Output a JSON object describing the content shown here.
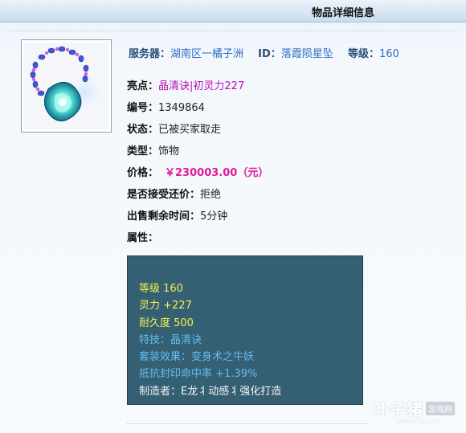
{
  "title": "物品详细信息",
  "header": {
    "server_label": "服务器：",
    "server_value": "湖南区一橘子洲",
    "id_label": "ID：",
    "id_value": "落霞陨星坠",
    "level_label": "等级：",
    "level_value": "160"
  },
  "details": {
    "highlight_label": "亮点：",
    "highlight_value": "晶清诀|初灵力227",
    "number_label": "编号：",
    "number_value": "1349864",
    "status_label": "状态：",
    "status_value": "已被买家取走",
    "type_label": "类型：",
    "type_value": "饰物",
    "price_label": "价格：",
    "price_value": "￥230003.00（元）",
    "counter_label": "是否接受还价：",
    "counter_value": "拒绝",
    "remaining_label": "出售剩余时间：",
    "remaining_value": "5分钟",
    "attr_label": "属性："
  },
  "attributes": [
    {
      "text": "等级 160",
      "color": "yellow"
    },
    {
      "text": "灵力 +227",
      "color": "yellow"
    },
    {
      "text": "耐久度 500",
      "color": "yellow"
    },
    {
      "text": "特技：晶清诀",
      "color": "blue"
    },
    {
      "text": "套装效果：变身术之牛妖",
      "color": "blue"
    },
    {
      "text": "抵抗封印命中率 +1.39%",
      "color": "blue"
    },
    {
      "text": "制造者：E龙丬动感丬强化打造",
      "color": "white"
    }
  ],
  "watermark": {
    "logo": "叶子猪",
    "tag": "游戏网",
    "url": "www.yzz.cn"
  },
  "colors": {
    "attr_bg": "#355f73",
    "yellow": "#f2f24e",
    "blue": "#63bdf2",
    "white": "#f4f4f4",
    "price": "#e0199a",
    "highlight": "#b414b4"
  }
}
